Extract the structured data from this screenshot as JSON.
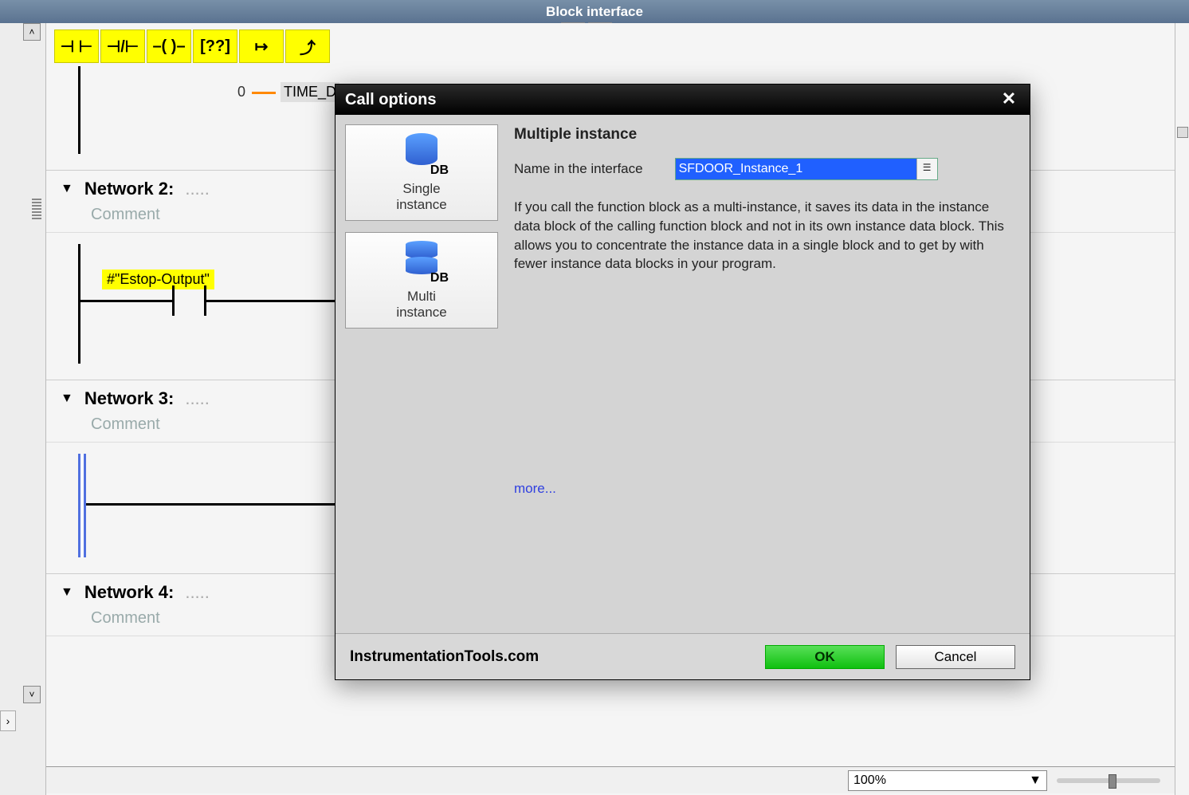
{
  "header": {
    "title": "Block interface"
  },
  "toolbar": {
    "items": [
      {
        "glyph": "⊣ ⊢"
      },
      {
        "glyph": "⊣/⊢"
      },
      {
        "glyph": "–( )–"
      },
      {
        "glyph": "[??]"
      },
      {
        "glyph": "↦"
      },
      {
        "glyph": "⤴"
      }
    ]
  },
  "net1": {
    "zero": "0",
    "time_label": "TIME_D"
  },
  "networks": [
    {
      "title": "Network 2:",
      "dots": ".....",
      "comment": "Comment",
      "tag": "#\"Estop-Output\""
    },
    {
      "title": "Network 3:",
      "dots": ".....",
      "comment": "Comment"
    },
    {
      "title": "Network 4:",
      "dots": ".....",
      "comment": "Comment"
    }
  ],
  "zoom": {
    "value": "100%"
  },
  "dialog": {
    "title": "Call options",
    "options": {
      "single": {
        "caption_l1": "Single",
        "caption_l2": "instance",
        "db": "DB"
      },
      "multi": {
        "caption_l1": "Multi",
        "caption_l2": "instance",
        "db": "DB"
      }
    },
    "right": {
      "heading": "Multiple instance",
      "name_label": "Name in the interface",
      "name_value": "SFDOOR_Instance_1",
      "description": "If you call the function block as a multi-instance, it saves its data in the instance data block of the calling function block and not in its own instance data block. This allows you to concentrate the instance data in a single block and to get by with fewer instance data blocks in your program.",
      "more": "more..."
    },
    "footer": {
      "watermark": "InstrumentationTools.com",
      "ok": "OK",
      "cancel": "Cancel"
    }
  }
}
